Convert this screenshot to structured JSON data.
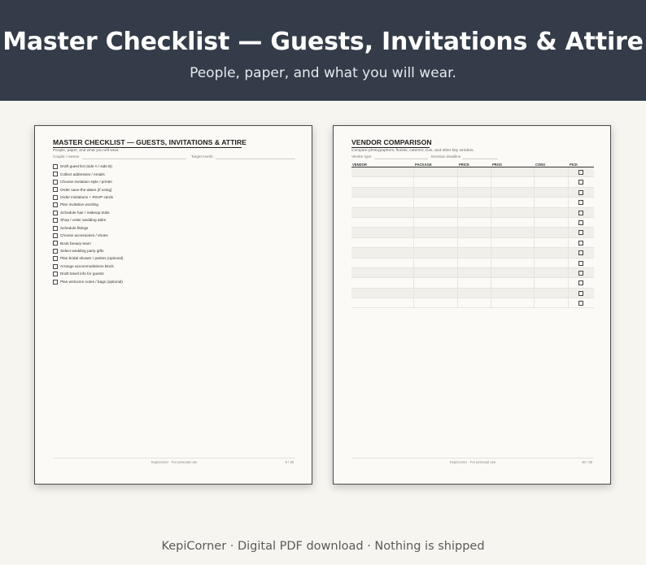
{
  "banner": {
    "title": "Master Checklist — Guests, Invitations & Attire",
    "subtitle": "People, paper, and what you will wear."
  },
  "left_page": {
    "title": "MASTER CHECKLIST — GUESTS, INVITATIONS & ATTIRE",
    "subtitle": "People, paper, and what you will wear.",
    "field_couple": "Couple / names",
    "field_target": "Target month",
    "items": [
      "Draft guest list (side A / side B)",
      "Collect addresses / emails",
      "Choose invitation style / printer",
      "Order save-the-dates (if using)",
      "Order invitations + RSVP cards",
      "Plan invitation wording",
      "Schedule hair / makeup trials",
      "Shop / order wedding attire",
      "Schedule fittings",
      "Choose accessories / shoes",
      "Book beauty team",
      "Select wedding party gifts",
      "Plan bridal shower / parties (optional)",
      "Arrange accommodations block",
      "Draft travel info for guests",
      "Plan welcome notes / bags (optional)"
    ],
    "footer_brand": "KepiCorner · For personal use",
    "footer_page": "9 / 38"
  },
  "right_page": {
    "title": "VENDOR COMPARISON",
    "subtitle": "Compare photographers, florists, caterers, DJs, and other key vendors.",
    "field_vendor_type": "Vendor type",
    "field_deadline": "Decision deadline",
    "columns": [
      "VENDOR",
      "PACKAGE",
      "PRICE",
      "PROS",
      "CONS",
      "PICK"
    ],
    "row_count": 14,
    "footer_brand": "KepiCorner · For personal use",
    "footer_page": "30 / 38"
  },
  "bottom": {
    "text": "KepiCorner  ·  Digital PDF download  ·  Nothing is shipped"
  },
  "colors": {
    "banner_bg": "#333c48",
    "page_bg": "#fbfaf6",
    "canvas_bg": "#f7f5f0"
  }
}
